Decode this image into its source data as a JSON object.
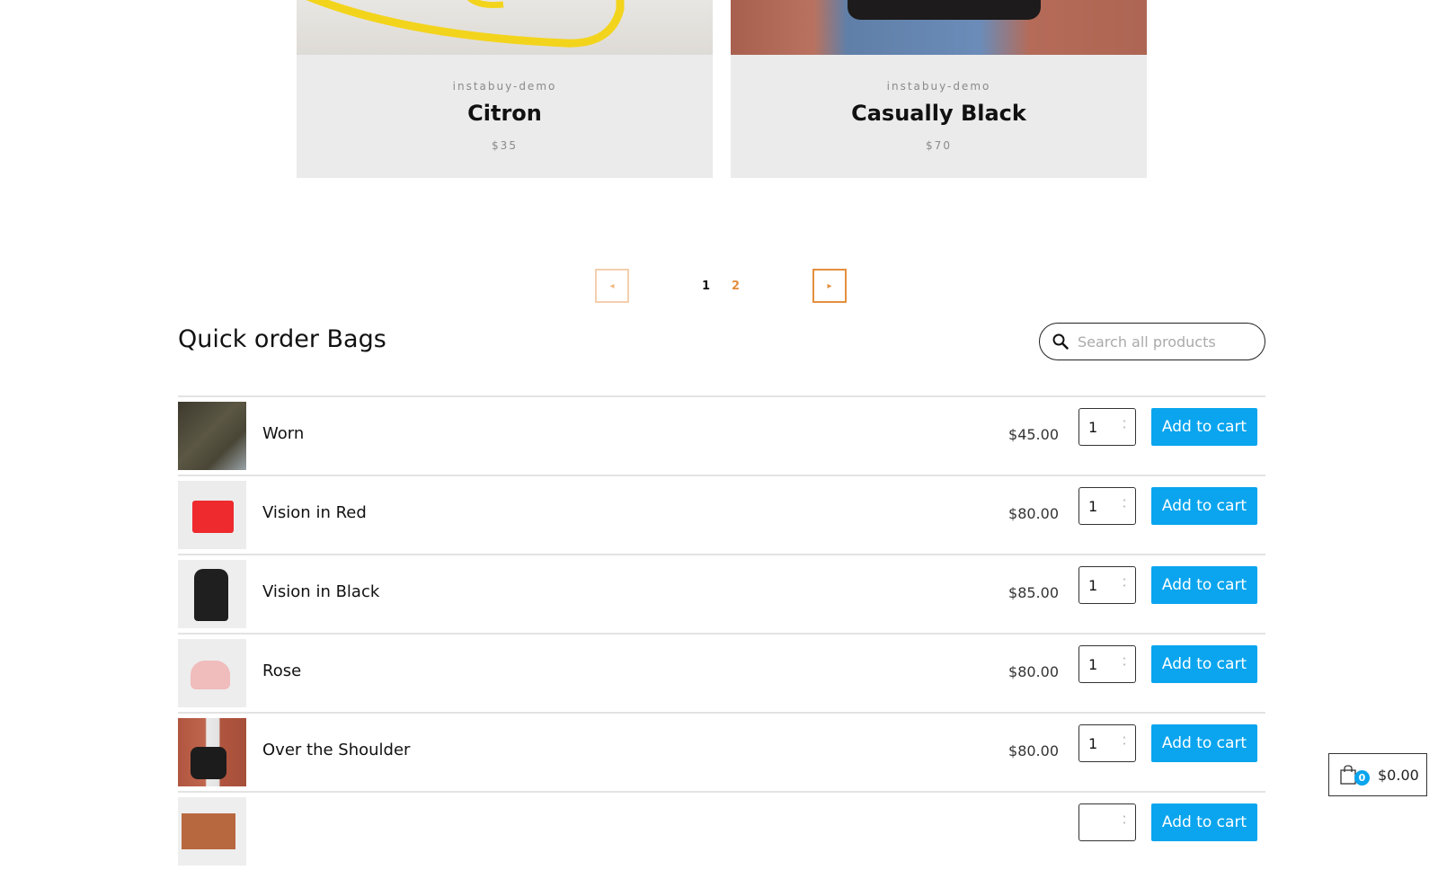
{
  "featured": [
    {
      "vendor": "instabuy-demo",
      "title": "Citron",
      "price": "$35",
      "image": "yellow-bag-photo"
    },
    {
      "vendor": "instabuy-demo",
      "title": "Casually Black",
      "price": "$70",
      "image": "black-bag-photo"
    }
  ],
  "pagination": {
    "prev_icon": "◂",
    "next_icon": "▸",
    "pages": [
      "1",
      "2"
    ],
    "current": "1",
    "colors": {
      "accent": "#e48f3e",
      "accent_light": "#f4cfae"
    }
  },
  "quick_order": {
    "title": "Quick order Bags",
    "search": {
      "placeholder": "Search all products",
      "value": ""
    },
    "add_label": "Add to cart",
    "items": [
      {
        "name": "Worn",
        "price": "$45.00",
        "qty": "1"
      },
      {
        "name": "Vision in Red",
        "price": "$80.00",
        "qty": "1"
      },
      {
        "name": "Vision in Black",
        "price": "$85.00",
        "qty": "1"
      },
      {
        "name": "Rose",
        "price": "$80.00",
        "qty": "1"
      },
      {
        "name": "Over the Shoulder",
        "price": "$80.00",
        "qty": "1"
      },
      {
        "name": "",
        "price": "",
        "qty": ""
      }
    ]
  },
  "cart": {
    "count": "0",
    "total": "$0.00"
  },
  "colors": {
    "button": "#0aa5ee",
    "card_bg": "#ebebeb"
  }
}
